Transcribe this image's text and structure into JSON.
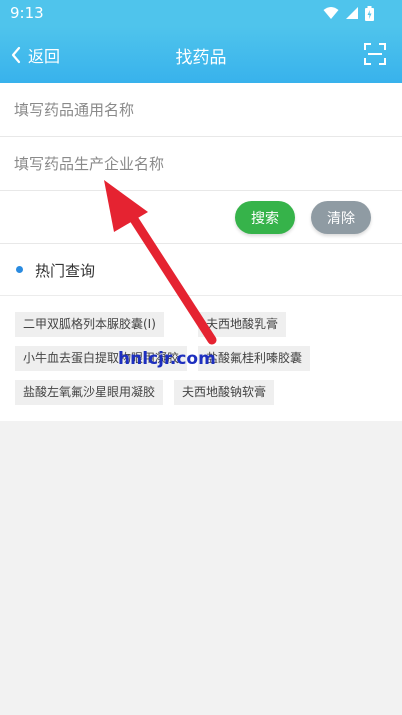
{
  "status_bar": {
    "time": "9:13",
    "icons": [
      "wifi-icon",
      "signal-icon",
      "battery-icon"
    ]
  },
  "app_bar": {
    "back_label": "返回",
    "title": "找药品",
    "scan_icon": "scan-icon"
  },
  "form": {
    "generic_name_placeholder": "填写药品通用名称",
    "manufacturer_placeholder": "填写药品生产企业名称",
    "search_label": "搜索",
    "clear_label": "清除"
  },
  "hot": {
    "title": "热门查询",
    "tags": [
      "二甲双胍格列本脲胶囊(Ⅰ)",
      "夫西地酸乳膏",
      "小牛血去蛋白提取物眼用凝胶",
      "盐酸氟桂利嗪胶囊",
      "盐酸左氧氟沙星眼用凝胶",
      "夫西地酸钠软膏"
    ]
  },
  "watermark": "hnlcjr.com",
  "colors": {
    "header": "#38b2ec",
    "search_button": "#36b34a",
    "clear_button": "#8f9ba3",
    "dot": "#2a8be0",
    "arrow": "#e52331"
  }
}
